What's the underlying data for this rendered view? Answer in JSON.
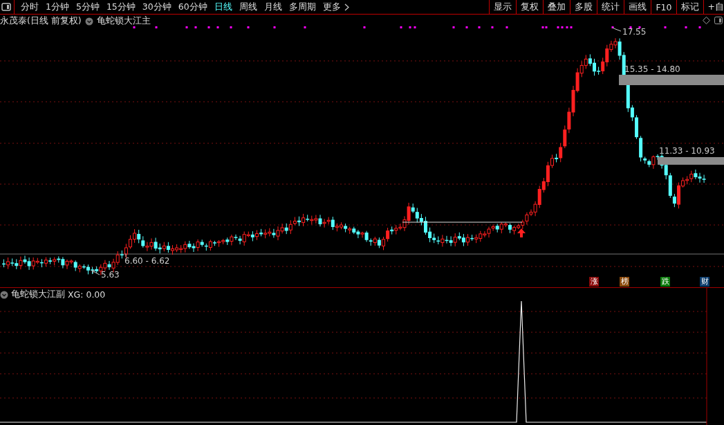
{
  "toolbar": {
    "periods": [
      {
        "label": "分时",
        "selected": false
      },
      {
        "label": "1分钟",
        "selected": false
      },
      {
        "label": "5分钟",
        "selected": false
      },
      {
        "label": "15分钟",
        "selected": false
      },
      {
        "label": "30分钟",
        "selected": false
      },
      {
        "label": "60分钟",
        "selected": false
      },
      {
        "label": "日线",
        "selected": true
      },
      {
        "label": "周线",
        "selected": false
      },
      {
        "label": "月线",
        "selected": false
      },
      {
        "label": "多周期",
        "selected": false
      },
      {
        "label": "更多",
        "selected": false
      }
    ],
    "buttons": [
      "显示",
      "复权",
      "叠加",
      "多股",
      "统计",
      "画线",
      "F10",
      "标记",
      "+自"
    ]
  },
  "main_chart": {
    "title": "永茂泰(日线 前复权)",
    "indicator": "龟蛇锁大江主",
    "annotations": [
      {
        "text": "17.55",
        "kind": "high"
      },
      {
        "text": "15.35 - 14.80",
        "kind": "zone"
      },
      {
        "text": "11.33 - 10.93",
        "kind": "zone"
      },
      {
        "text": "6.60 - 6.62",
        "kind": "range"
      },
      {
        "text": "5.63",
        "kind": "low"
      }
    ],
    "badges": [
      {
        "text": "涨",
        "color": "#8b0a0a"
      },
      {
        "text": "榜",
        "color": "#8b4a0c"
      },
      {
        "text": "跌",
        "color": "#0a7a0a"
      },
      {
        "text": "财",
        "color": "#0c3c6c"
      }
    ]
  },
  "sub_chart": {
    "title": "龟蛇锁大江副",
    "reading": "XG: 0.00"
  }
}
